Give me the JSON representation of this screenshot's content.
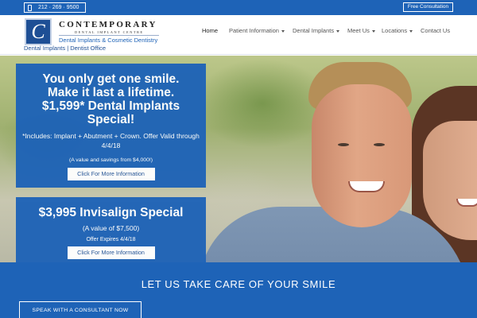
{
  "topbar": {
    "phone": "212 · 269 · 9500",
    "phone_icon": "mobile-phone-icon",
    "consult_label": "Free Consultation"
  },
  "header": {
    "logo": {
      "mark": "C",
      "name": "CONTEMPORARY",
      "subname": "DENTAL IMPLANT CENTRE",
      "tagline": "Dental Implants & Cosmetic Dentistry",
      "caption": "Dental Implants | Dentist Office"
    },
    "nav": [
      {
        "label": "Home",
        "dropdown": false
      },
      {
        "label": "Patient Information",
        "dropdown": true
      },
      {
        "label": "Dental Implants",
        "dropdown": true
      },
      {
        "label": "Meet Us",
        "dropdown": true
      },
      {
        "label": "Locations",
        "dropdown": true
      },
      {
        "label": "Contact Us",
        "dropdown": false
      }
    ]
  },
  "promo1": {
    "title_line1": "You only get one smile.",
    "title_line2": "Make it last a lifetime.",
    "title_line3": "$1,599* Dental Implants",
    "title_line4": "Special!",
    "includes": "*Includes: Implant + Abutment + Crown. Offer Valid through 4/4/18",
    "value": "(A value and savings from $4,000!)",
    "button": "Click For More Information"
  },
  "promo2": {
    "title": "$3,995 Invisalign Special",
    "value": "(A value of $7,500)",
    "expires": "Offer Expires 4/4/18",
    "button": "Click For More Information"
  },
  "band": {
    "title": "LET US TAKE CARE OF YOUR SMILE",
    "button": "SPEAK WITH A CONSULTANT NOW"
  },
  "colors": {
    "brand_blue": "#1e63b7",
    "logo_navy": "#1e4f95"
  }
}
